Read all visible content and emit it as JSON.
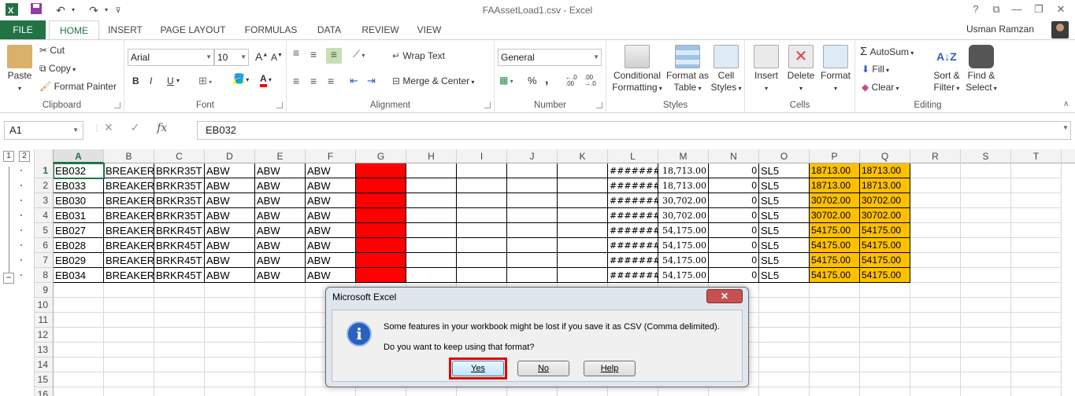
{
  "title_bar": {
    "title": "FAAssetLoad1.csv - Excel",
    "help": "?",
    "minimize": "—",
    "restore": "❐",
    "close": "✕",
    "ribbon_display": "⧉"
  },
  "tabs": {
    "file": "FILE",
    "items": [
      "HOME",
      "INSERT",
      "PAGE LAYOUT",
      "FORMULAS",
      "DATA",
      "REVIEW",
      "VIEW"
    ],
    "user": "Usman Ramzan"
  },
  "ribbon": {
    "clipboard": {
      "label": "Clipboard",
      "paste": "Paste",
      "cut": "Cut",
      "copy": "Copy",
      "format_painter": "Format Painter"
    },
    "font": {
      "label": "Font",
      "font_name": "Arial",
      "font_size": "10",
      "bold": "B",
      "italic": "I",
      "underline": "U"
    },
    "alignment": {
      "label": "Alignment",
      "wrap_text": "Wrap Text",
      "merge_center": "Merge & Center"
    },
    "number": {
      "label": "Number",
      "format": "General",
      "percent": "%",
      "comma": ","
    },
    "styles": {
      "label": "Styles",
      "conditional": "Conditional Formatting",
      "format_table": "Format as Table",
      "cell_styles": "Cell Styles"
    },
    "cells": {
      "label": "Cells",
      "insert": "Insert",
      "delete": "Delete",
      "format": "Format"
    },
    "editing": {
      "label": "Editing",
      "autosum": "AutoSum",
      "fill": "Fill",
      "clear": "Clear",
      "sort_filter": "Sort & Filter",
      "find_select": "Find & Select"
    }
  },
  "formula_bar": {
    "name_box": "A1",
    "fx": "fx",
    "formula": "EB032"
  },
  "grid": {
    "outline_levels": [
      "1",
      "2"
    ],
    "collapse": "−",
    "columns": [
      "A",
      "B",
      "C",
      "D",
      "E",
      "F",
      "G",
      "H",
      "I",
      "J",
      "K",
      "L",
      "M",
      "N",
      "O",
      "P",
      "Q",
      "R",
      "S",
      "T"
    ],
    "row_numbers": [
      "1",
      "2",
      "3",
      "4",
      "5",
      "6",
      "7",
      "8",
      "9",
      "10",
      "11",
      "12",
      "13",
      "14",
      "15",
      "16"
    ],
    "rows": [
      [
        "EB032",
        "BREAKER",
        "BRKR35T",
        "ABW",
        "ABW",
        "ABW",
        "",
        "",
        "",
        "",
        "",
        "########",
        "18,713.00",
        "0",
        "SL5",
        "18713.00",
        "18713.00"
      ],
      [
        "EB033",
        "BREAKER",
        "BRKR35T",
        "ABW",
        "ABW",
        "ABW",
        "",
        "",
        "",
        "",
        "",
        "########",
        "18,713.00",
        "0",
        "SL5",
        "18713.00",
        "18713.00"
      ],
      [
        "EB030",
        "BREAKER",
        "BRKR35T",
        "ABW",
        "ABW",
        "ABW",
        "",
        "",
        "",
        "",
        "",
        "########",
        "30,702.00",
        "0",
        "SL5",
        "30702.00",
        "30702.00"
      ],
      [
        "EB031",
        "BREAKER",
        "BRKR35T",
        "ABW",
        "ABW",
        "ABW",
        "",
        "",
        "",
        "",
        "",
        "########",
        "30,702.00",
        "0",
        "SL5",
        "30702.00",
        "30702.00"
      ],
      [
        "EB027",
        "BREAKER",
        "BRKR45T",
        "ABW",
        "ABW",
        "ABW",
        "",
        "",
        "",
        "",
        "",
        "########",
        "54,175.00",
        "0",
        "SL5",
        "54175.00",
        "54175.00"
      ],
      [
        "EB028",
        "BREAKER",
        "BRKR45T",
        "ABW",
        "ABW",
        "ABW",
        "",
        "",
        "",
        "",
        "",
        "########",
        "54,175.00",
        "0",
        "SL5",
        "54175.00",
        "54175.00"
      ],
      [
        "EB029",
        "BREAKER",
        "BRKR45T",
        "ABW",
        "ABW",
        "ABW",
        "",
        "",
        "",
        "",
        "",
        "########",
        "54,175.00",
        "0",
        "SL5",
        "54175.00",
        "54175.00"
      ],
      [
        "EB034",
        "BREAKER",
        "BRKR45T",
        "ABW",
        "ABW",
        "ABW",
        "",
        "",
        "",
        "",
        "",
        "########",
        "54,175.00",
        "0",
        "SL5",
        "54175.00",
        "54175.00"
      ]
    ],
    "colors": {
      "red_fill": "#ff0000",
      "orange_fill": "#ffc000",
      "accent": "#217346"
    }
  },
  "dialog": {
    "title": "Microsoft Excel",
    "close": "✕",
    "icon": "i",
    "message1": "Some features in your workbook might be lost if you save it as CSV (Comma delimited).",
    "message2": "Do you want to keep using that format?",
    "yes": "Yes",
    "no": "No",
    "help": "Help"
  }
}
